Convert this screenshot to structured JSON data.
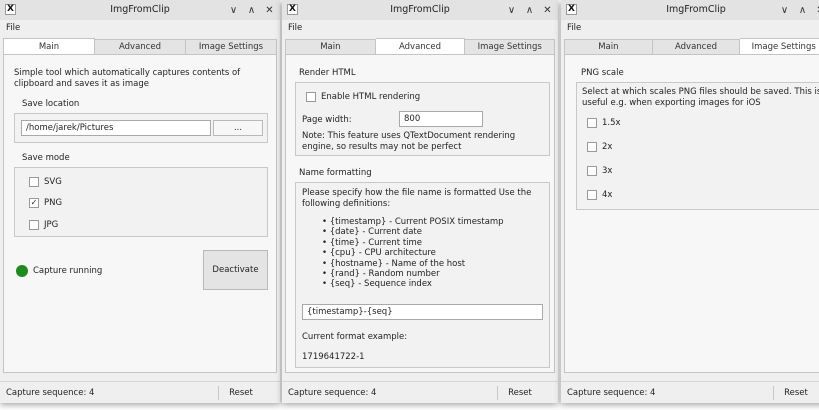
{
  "window": {
    "title": "ImgFromClip",
    "app_icon": "X",
    "controls": {
      "minimize": "∨",
      "maximize": "∧",
      "close": "✕"
    }
  },
  "menu": {
    "file": "File"
  },
  "tabs": [
    "Main",
    "Advanced",
    "Image Settings"
  ],
  "main": {
    "description": "Simple tool which automatically captures contents of clipboard and saves it as image",
    "save_location": {
      "label": "Save location",
      "path": "/home/jarek/Pictures",
      "browse": "..."
    },
    "save_mode": {
      "label": "Save mode",
      "options": [
        {
          "label": "SVG",
          "checked": false
        },
        {
          "label": "PNG",
          "checked": true
        },
        {
          "label": "JPG",
          "checked": false
        }
      ]
    },
    "capture_status": "Capture running",
    "status_color": "#1f8a1f",
    "deactivate": "Deactivate"
  },
  "advanced": {
    "render_html": {
      "label": "Render HTML",
      "enable_label": "Enable HTML rendering",
      "enable_checked": false,
      "page_width_label": "Page width:",
      "page_width_value": "800",
      "note": "Note: This feature uses QTextDocument rendering engine, so results may not be perfect"
    },
    "name_formatting": {
      "label": "Name formatting",
      "description": "Please specify how the file name is formatted Use the following definitions:",
      "definitions": [
        "{timestamp} - Current POSIX timestamp",
        "{date} - Current date",
        "{time} - Current time",
        "{cpu} - CPU architecture",
        "{hostname} - Name of the host",
        "{rand} - Random number",
        "{seq} - Sequence index"
      ],
      "format_value": "{timestamp}-{seq}",
      "example_label": "Current format example:",
      "example_value": "1719641722-1"
    }
  },
  "image_settings": {
    "png_scale": {
      "label": "PNG scale",
      "description": "Select at which scales PNG files should be saved. This is useful e.g. when exporting images for iOS",
      "options": [
        {
          "label": "1.5x",
          "checked": false
        },
        {
          "label": "2x",
          "checked": false
        },
        {
          "label": "3x",
          "checked": false
        },
        {
          "label": "4x",
          "checked": false
        }
      ]
    }
  },
  "status": {
    "sequence": "Capture sequence: 4",
    "reset": "Reset"
  }
}
